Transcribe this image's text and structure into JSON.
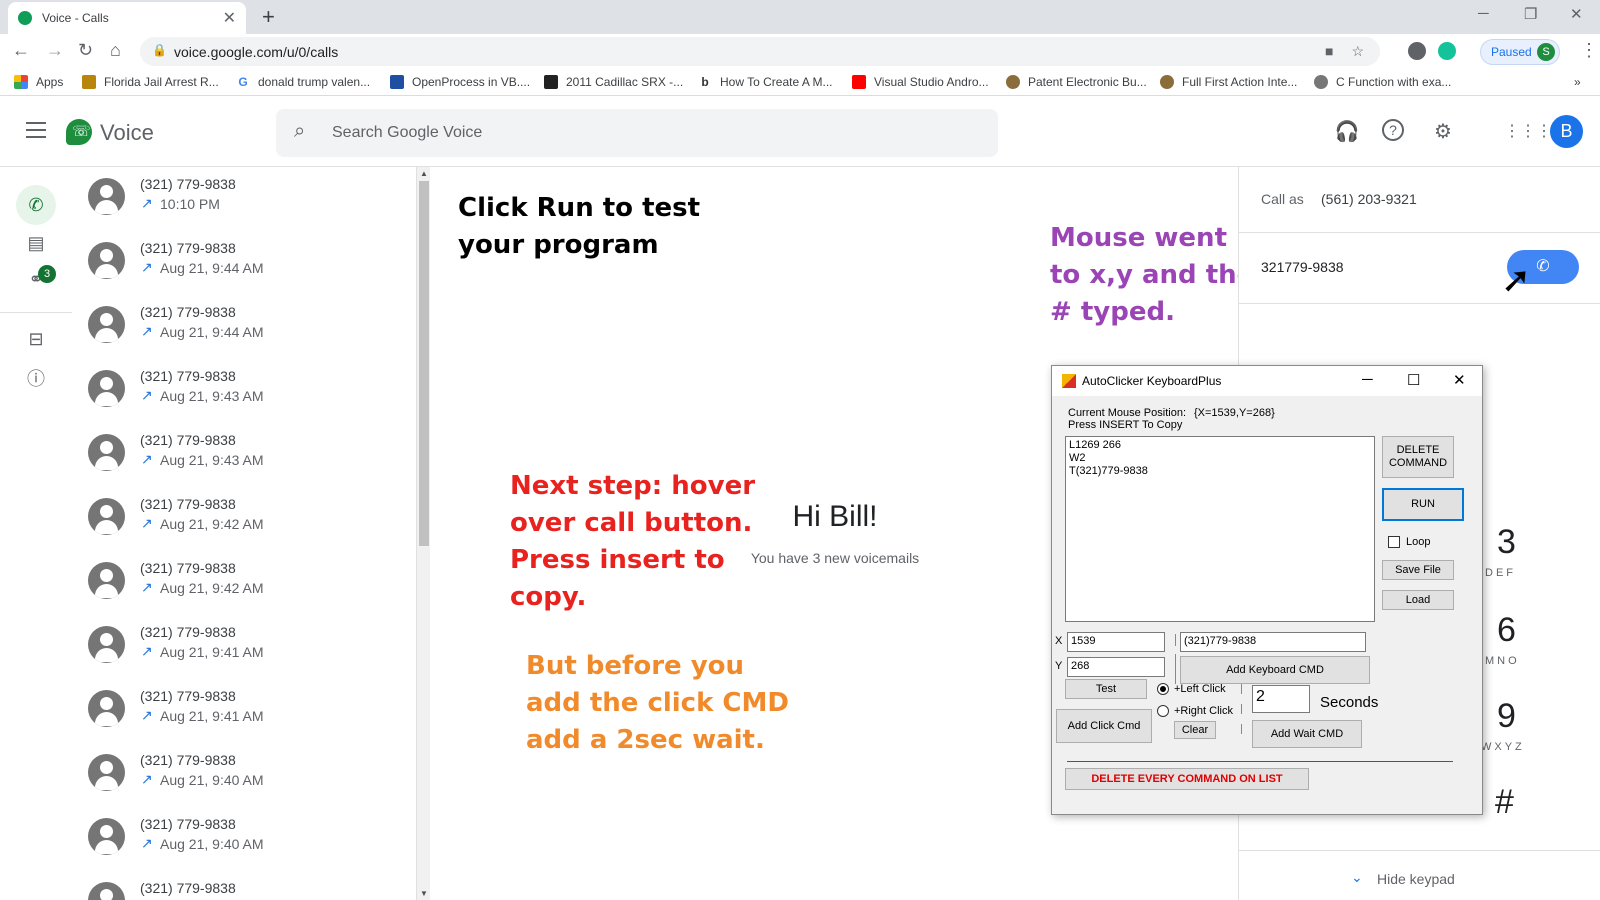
{
  "browser": {
    "tab_title": "Voice - Calls",
    "url": "voice.google.com/u/0/calls",
    "paused_label": "Paused",
    "profile_letter": "S",
    "bookmarks": [
      {
        "label": "Apps",
        "icon": "apps-grid-icon"
      },
      {
        "label": "Florida Jail Arrest R...",
        "icon": "jail-icon"
      },
      {
        "label": "donald trump valen...",
        "icon": "google-icon"
      },
      {
        "label": "OpenProcess in VB....",
        "icon": "vs-icon"
      },
      {
        "label": "2011 Cadillac SRX -...",
        "icon": "c-icon"
      },
      {
        "label": "How To Create A M...",
        "icon": "bing-icon"
      },
      {
        "label": "Visual Studio Andro...",
        "icon": "youtube-icon"
      },
      {
        "label": "Patent Electronic Bu...",
        "icon": "patent-icon"
      },
      {
        "label": "Full First Action Inte...",
        "icon": "patent-icon"
      },
      {
        "label": "C Function with exa...",
        "icon": "globe-icon"
      }
    ]
  },
  "voice": {
    "app_title": "Voice",
    "search_placeholder": "Search Google Voice",
    "avatar_letter": "B",
    "voicemail_badge": "3",
    "calls": [
      {
        "number": "(321) 779-9838",
        "time": "10:10 PM"
      },
      {
        "number": "(321) 779-9838",
        "time": "Aug 21, 9:44 AM"
      },
      {
        "number": "(321) 779-9838",
        "time": "Aug 21, 9:44 AM"
      },
      {
        "number": "(321) 779-9838",
        "time": "Aug 21, 9:43 AM"
      },
      {
        "number": "(321) 779-9838",
        "time": "Aug 21, 9:43 AM"
      },
      {
        "number": "(321) 779-9838",
        "time": "Aug 21, 9:42 AM"
      },
      {
        "number": "(321) 779-9838",
        "time": "Aug 21, 9:42 AM"
      },
      {
        "number": "(321) 779-9838",
        "time": "Aug 21, 9:41 AM"
      },
      {
        "number": "(321) 779-9838",
        "time": "Aug 21, 9:41 AM"
      },
      {
        "number": "(321) 779-9838",
        "time": "Aug 21, 9:40 AM"
      },
      {
        "number": "(321) 779-9838",
        "time": "Aug 21, 9:40 AM"
      },
      {
        "number": "(321) 779-9838",
        "time": ""
      }
    ],
    "greeting": "Hi Bill!",
    "voicemail_text": "You have 3 new voicemails",
    "call_as_label": "Call as",
    "call_as_number": "(561) 203-9321",
    "dial_number": "321779-9838",
    "keypad_keys": [
      {
        "digit": "3",
        "letters": "DEF"
      },
      {
        "digit": "6",
        "letters": "MNO"
      },
      {
        "digit": "9",
        "letters": "WXYZ"
      },
      {
        "digit": "#",
        "letters": ""
      }
    ],
    "hide_keypad": "Hide keypad"
  },
  "annotations": {
    "run_note_line1": "Click Run to test",
    "run_note_line2": "your program",
    "mouse_note_line1": "Mouse went",
    "mouse_note_line2": "to x,y and the",
    "mouse_note_line3": "# typed.",
    "next_step_line1": "Next step: hover",
    "next_step_line2": "over call button.",
    "next_step_line3": "Press insert to",
    "next_step_line4": "copy.",
    "before_line1": "But before you",
    "before_line2": "add the click CMD",
    "before_line3": "add a 2sec wait.",
    "colors": {
      "black": "#000000",
      "purple": "#9b44b6",
      "red": "#e8221f",
      "orange": "#f08a2a"
    }
  },
  "autoclicker": {
    "title": "AutoClicker KeyboardPlus",
    "current_mouse_label": "Current Mouse Position:",
    "current_mouse_value": "{X=1539,Y=268}",
    "press_insert": "Press INSERT To Copy",
    "commands": "L1269 266\nW2\nT(321)779-9838",
    "delete_command_line1": "DELETE",
    "delete_command_line2": "COMMAND",
    "run": "RUN",
    "loop": "Loop",
    "save_file": "Save File",
    "load": "Load",
    "x_label": "X",
    "x_value": "1539",
    "y_label": "Y",
    "y_value": "268",
    "keyboard_value": "(321)779-9838",
    "add_keyboard_cmd": "Add Keyboard CMD",
    "test": "Test",
    "left_click": "+Left Click",
    "right_click": "+Right Click",
    "wait_value": "2",
    "seconds": "Seconds",
    "add_click_cmd": "Add Click Cmd",
    "clear": "Clear",
    "add_wait_cmd": "Add Wait CMD",
    "delete_every": "DELETE EVERY COMMAND ON LIST"
  }
}
